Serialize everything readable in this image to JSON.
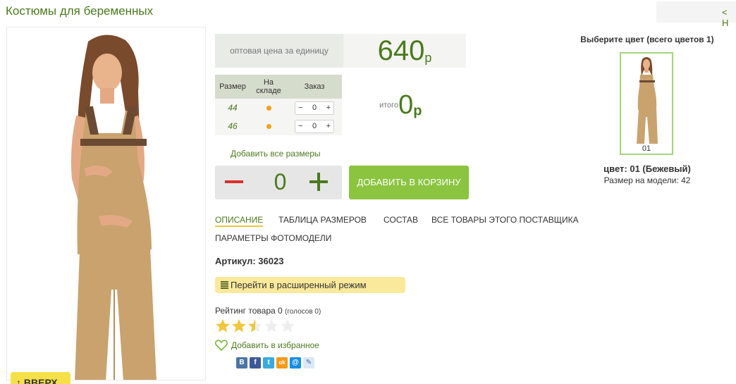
{
  "header": {
    "title": "Костюмы для беременных",
    "back_link": "< Н"
  },
  "product": {
    "up_button": "ВВЕРХ",
    "price_label": "оптовая цена за единицу",
    "price": "640",
    "currency": "р",
    "sizes_table": {
      "headers": {
        "size": "Размер",
        "stock": "На складе",
        "order": "Заказ"
      },
      "rows": [
        {
          "size": "44",
          "qty": "0"
        },
        {
          "size": "46",
          "qty": "0"
        }
      ]
    },
    "total": {
      "label": "итого",
      "value": "0",
      "currency": "р"
    },
    "add_all_sizes": "Добавить все размеры",
    "stepper": {
      "minus": "−",
      "value": "0",
      "plus": "+"
    },
    "add_to_cart": "ДОБАВИТЬ В КОРЗИНУ",
    "tabs": [
      {
        "label": "ОПИСАНИЕ",
        "active": true
      },
      {
        "label": "ТАБЛИЦА РАЗМЕРОВ"
      },
      {
        "label": "СОСТАВ"
      },
      {
        "label": "ВСЕ ТОВАРЫ ЭТОГО ПОСТАВЩИКА"
      },
      {
        "label": "ПАРАМЕТРЫ ФОТОМОДЕЛИ"
      }
    ],
    "article": "Артикул: 36023",
    "extended_mode": "Перейти в расширенный режим",
    "rating": {
      "label": "Рейтинг товара 0",
      "votes": "(голосов 0)",
      "stars_filled": 2.5,
      "stars_total": 5
    },
    "favorite": "Добавить в избранное",
    "social": [
      "В",
      "f",
      "t",
      "ok",
      "@",
      "✎"
    ]
  },
  "colors": {
    "title": "Выберите цвет (всего цветов 1)",
    "thumb_code": "01",
    "color_name": "цвет: 01 (Бежевый)",
    "model_size": "Размер на модели: 42"
  },
  "theme": {
    "accent": "#4a7a1e",
    "cart": "#8bc43f",
    "star": "#f0c63c",
    "minus": "#d9302a"
  }
}
